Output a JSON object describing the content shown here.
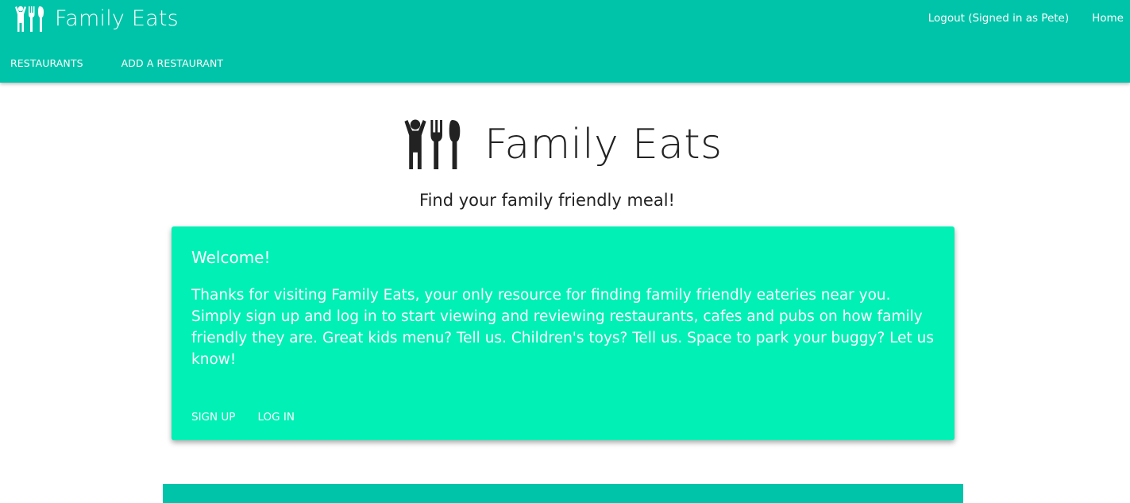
{
  "header": {
    "brand_name": "Family Eats",
    "brand_icon": "family-cutlery-logo-icon",
    "logout_label": "Logout (Signed in as Pete)",
    "home_label": "Home",
    "nav": [
      {
        "label": "RESTAURANTS"
      },
      {
        "label": "ADD A RESTAURANT"
      }
    ]
  },
  "hero": {
    "title": "Family Eats",
    "tagline": "Find your family friendly meal!"
  },
  "welcome_card": {
    "title": "Welcome!",
    "body": "Thanks for visiting Family Eats, your only resource for finding family friendly eateries near you. Simply sign up and log in to start viewing and reviewing restaurants, cafes and pubs on how family friendly they are. Great kids menu? Tell us. Children's toys? Tell us. Space to park your buggy? Let us know!",
    "actions": [
      {
        "label": "SIGN UP"
      },
      {
        "label": "LOG IN"
      }
    ]
  },
  "colors": {
    "header_bg": "#00c4a9",
    "card_bg": "#00f0b5",
    "text_dark": "#222222"
  }
}
